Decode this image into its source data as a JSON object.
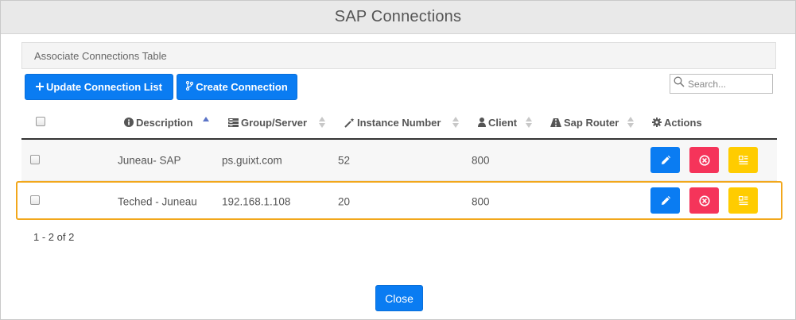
{
  "dialog": {
    "title": "SAP Connections"
  },
  "section": {
    "title": "Associate Connections Table"
  },
  "toolbar": {
    "update_label": "Update Connection List",
    "create_label": "Create Connection",
    "update_icon": "plus-icon",
    "create_icon": "branch-icon"
  },
  "search": {
    "placeholder": "Search..."
  },
  "table": {
    "columns": [
      {
        "label": "Description",
        "icon": "info-circle-icon",
        "sort": "ascending"
      },
      {
        "label": "Group/Server",
        "icon": "server-icon",
        "sort": "none"
      },
      {
        "label": "Instance Number",
        "icon": "magic-wand-icon",
        "sort": "none"
      },
      {
        "label": "Client",
        "icon": "user-icon",
        "sort": "none"
      },
      {
        "label": "Sap Router",
        "icon": "road-icon",
        "sort": "none"
      },
      {
        "label": "Actions",
        "icon": "gear-icon"
      }
    ],
    "rows": [
      {
        "description": "Juneau- SAP",
        "group_server": "ps.guixt.com",
        "instance_number": "52",
        "client": "800",
        "sap_router": ""
      },
      {
        "description": "Teched - Juneau",
        "group_server": "192.168.1.108",
        "instance_number": "20",
        "client": "800",
        "sap_router": ""
      }
    ],
    "action_icons": [
      "pencil-icon",
      "x-circle-icon",
      "details-icon"
    ],
    "colors": {
      "edit": "#0a7cf2",
      "delete": "#f5345a",
      "details": "#ffcc00",
      "highlight": "#f2a71b"
    }
  },
  "pagination": {
    "label": "1 - 2 of 2"
  },
  "footer": {
    "close_label": "Close"
  }
}
